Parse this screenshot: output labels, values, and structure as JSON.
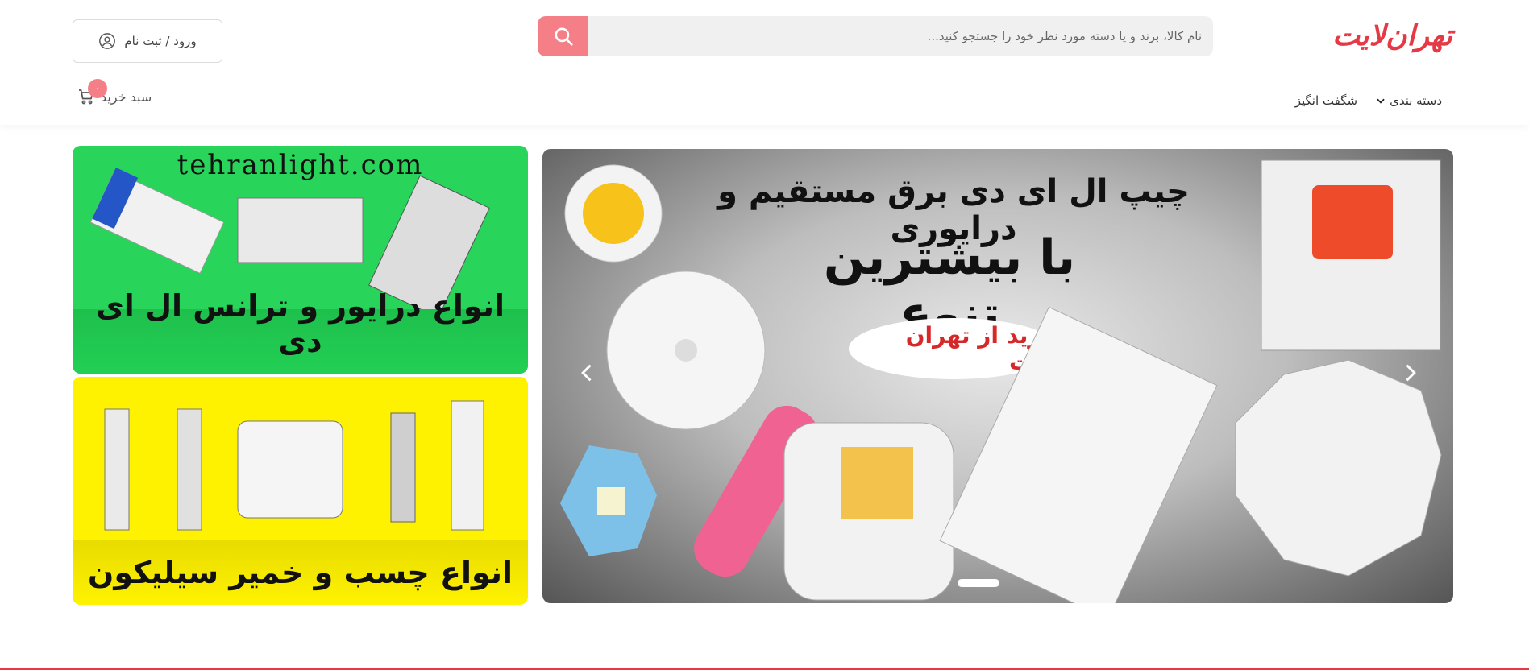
{
  "header": {
    "logo_text": "تهران‌لایت",
    "search": {
      "placeholder": "نام کالا، برند و یا دسته مورد نظر خود را جستجو کنید..."
    },
    "login_label": "ورود / ثبت نام",
    "nav": [
      {
        "label": "دسته بندی"
      },
      {
        "label": "شگفت انگیز"
      }
    ],
    "cart": {
      "label": "سبد خرید",
      "count": "۰"
    }
  },
  "slider": {
    "line1": "چیپ ال ای دی برق مستقیم و درایوری",
    "line2": "با بیشترین تنوع",
    "pill": "خرید از تهران لایت"
  },
  "banners": [
    {
      "url": "tehranlight.com",
      "title": "انواع درایور و ترانس ال ای دی"
    },
    {
      "title": "انواع چسب و خمیر سیلیکون"
    }
  ],
  "colors": {
    "brand": "#e63946",
    "search_button": "#f47f86",
    "search_bg": "#f0f0f1"
  }
}
